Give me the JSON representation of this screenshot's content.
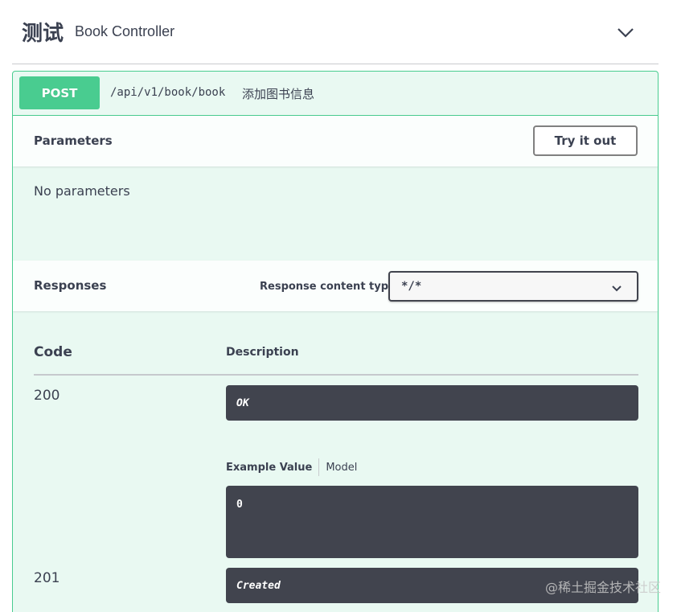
{
  "tag": {
    "name": "测试",
    "description": "Book Controller"
  },
  "operation": {
    "method": "POST",
    "path": "/api/v1/book/book",
    "summary": "添加图书信息"
  },
  "parameters": {
    "title": "Parameters",
    "try_button_label": "Try it out",
    "empty_text": "No parameters"
  },
  "responses": {
    "title": "Responses",
    "content_type_label": "Response content type",
    "content_type_value": "*/*",
    "columns": {
      "code": "Code",
      "description": "Description"
    },
    "rows": [
      {
        "code": "200",
        "description": "OK",
        "example_tab": "Example Value",
        "model_tab": "Model",
        "example_value": "0"
      },
      {
        "code": "201",
        "description": "Created"
      }
    ]
  },
  "watermark": "@稀土掘金技术社区",
  "colors": {
    "post_accent": "#49cc90",
    "dark_box": "#41444e",
    "text": "#3b4151"
  }
}
